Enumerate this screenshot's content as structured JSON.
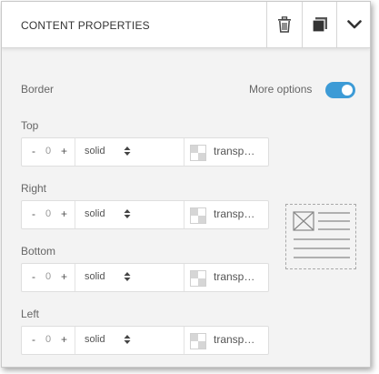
{
  "header": {
    "title": "CONTENT PROPERTIES"
  },
  "icons": {
    "delete": "trash-icon",
    "duplicate": "duplicate-icon",
    "collapse": "chevron-down-icon"
  },
  "border": {
    "label": "Border",
    "more_options_label": "More options",
    "more_options_enabled": true
  },
  "sides": [
    {
      "label": "Top",
      "value": "0",
      "style": "solid",
      "color": "transp…"
    },
    {
      "label": "Right",
      "value": "0",
      "style": "solid",
      "color": "transp…"
    },
    {
      "label": "Bottom",
      "value": "0",
      "style": "solid",
      "color": "transp…"
    },
    {
      "label": "Left",
      "value": "0",
      "style": "solid",
      "color": "transp…"
    }
  ],
  "stepper": {
    "minus": "-",
    "plus": "+"
  },
  "colors": {
    "toggle_on": "#3d9bd6",
    "panel_bg": "#f3f3f3"
  }
}
